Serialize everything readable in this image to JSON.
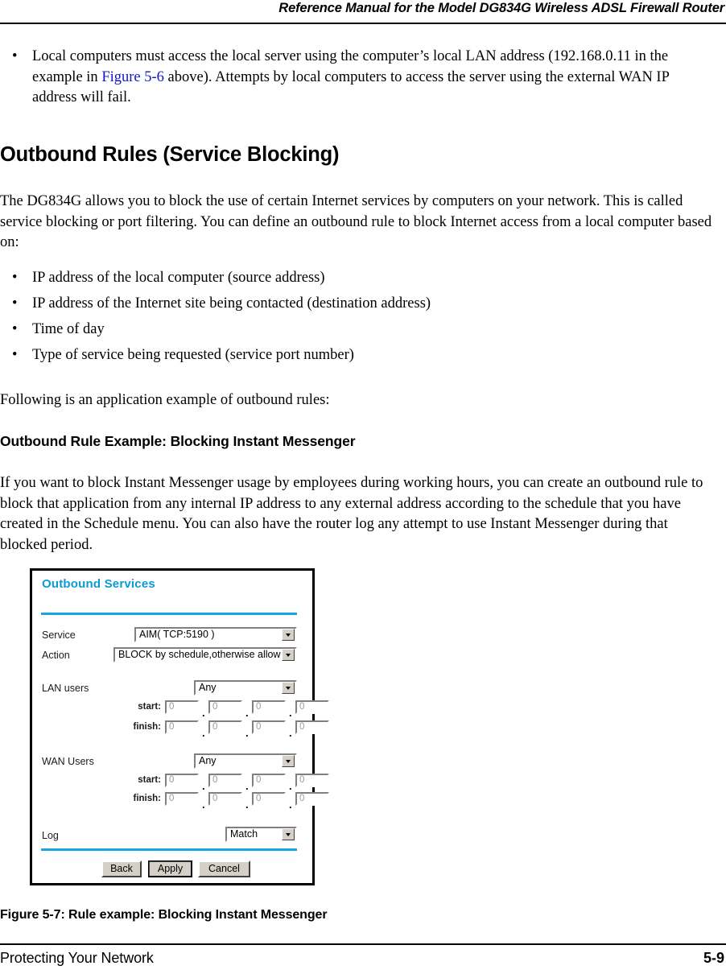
{
  "header": {
    "title": "Reference Manual for the Model DG834G Wireless ADSL Firewall Router"
  },
  "intro_bullet": {
    "marker": "•",
    "text_part1": "Local computers must access the local server using the computer’s local LAN address (192.168.0.11 in the example in ",
    "link": "Figure 5-6",
    "text_part2": " above). Attempts by local computers to access the server using the external WAN IP address will fail."
  },
  "section": {
    "title": "Outbound Rules (Service Blocking)",
    "paragraph": "The DG834G allows you to block the use of certain Internet services by computers on your network. This is called service blocking or port filtering. You can define an outbound rule to block Internet access from a local computer based on:",
    "bullets": [
      {
        "marker": "•",
        "text": "IP address of the local computer (source address)"
      },
      {
        "marker": "•",
        "text": "IP address of the Internet site being contacted (destination address)"
      },
      {
        "marker": "•",
        "text": "Time of day"
      },
      {
        "marker": "•",
        "text": "Type of service being requested (service port number)"
      }
    ],
    "following_line": "Following is an application example of outbound rules:"
  },
  "subsection": {
    "title": "Outbound Rule Example: Blocking Instant Messenger",
    "paragraph": "If you want to block Instant Messenger usage by employees during working hours, you can create an outbound rule to block that application from any internal IP address to any external address according to the schedule that you have created in the Schedule menu. You can also have the router log any attempt to use Instant Messenger during that blocked period."
  },
  "screenshot": {
    "panel_title": "Outbound Services",
    "fields": {
      "service_label": "Service",
      "service_value": "AIM( TCP:5190 )",
      "action_label": "Action",
      "action_value": "BLOCK by schedule,otherwise allow",
      "lan_users_label": "LAN users",
      "lan_users_value": "Any",
      "wan_users_label": "WAN Users",
      "wan_users_value": "Any",
      "log_label": "Log",
      "log_value": "Match",
      "start_label": "start:",
      "finish_label": "finish:",
      "separator": "."
    },
    "lan_start_octets": [
      "0",
      "0",
      "0",
      "0"
    ],
    "lan_finish_octets": [
      "0",
      "0",
      "0",
      "0"
    ],
    "wan_start_octets": [
      "0",
      "0",
      "0",
      "0"
    ],
    "wan_finish_octets": [
      "0",
      "0",
      "0",
      "0"
    ],
    "buttons": {
      "back": "Back",
      "apply": "Apply",
      "cancel": "Cancel"
    },
    "colors": {
      "panel_title": "#0b9ad6",
      "rule": "#17a6e0",
      "button_face": "#d4d0c8"
    }
  },
  "figure_caption": "Figure 5-7:  Rule example: Blocking Instant Messenger",
  "footer": {
    "left": "Protecting Your Network",
    "right": "5-9"
  }
}
